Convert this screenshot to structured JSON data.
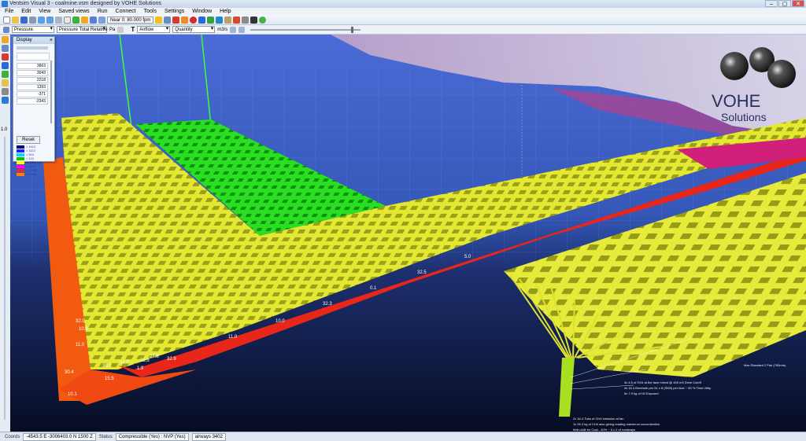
{
  "window": {
    "title": "Ventsim Visual 3 - coalmine.vsm designed by VOHE Solutions",
    "buttons": [
      "–",
      "▢",
      "✕"
    ]
  },
  "menu": [
    "File",
    "Edit",
    "View",
    "Saved views",
    "Run",
    "Connect",
    "Tools",
    "Settings",
    "Window",
    "Help"
  ],
  "toolbar": {
    "speed_label": "Near 0: 80.000 fpm",
    "icons": [
      "new-icon",
      "open-icon",
      "save-icon",
      "print-icon",
      "undo-icon",
      "redo-icon",
      "select-icon",
      "add-icon",
      "edit-icon",
      "copy-icon",
      "move-icon",
      "delete-icon",
      "info-icon",
      "block-icon",
      "fan-icon",
      "view-icon",
      "simulate-icon",
      "heat-icon",
      "contaminant-icon",
      "gas-icon",
      "settings-icon",
      "camera-icon",
      "help-icon"
    ]
  },
  "toolbar2": {
    "data_select": "Pressure",
    "sub_select": "Pressure Total Relative",
    "unit_hint": "Pa",
    "text_prefix": "T",
    "text_select": "Airflow",
    "text_sub_select": "Quantity",
    "text_unit": "m3/s"
  },
  "display_panel": {
    "title": "Display",
    "values": [
      "3663",
      "3043",
      "2218",
      "1393",
      "-371",
      "-2343"
    ],
    "reset": "Reset",
    "legend": [
      {
        "color": "#000080",
        "label": "> 1612"
      },
      {
        "color": "#2020ff",
        "label": "> 1113"
      },
      {
        "color": "#00d8ff",
        "label": "> 614"
      },
      {
        "color": "#10c010",
        "label": "> 115"
      },
      {
        "color": "#ffff00",
        "label": "> -384"
      },
      {
        "color": "#ff00ff",
        "label": "> -883"
      },
      {
        "color": "#ff2020",
        "label": "> -1382"
      },
      {
        "color": "#ff8000",
        "label": "> -1881"
      },
      {
        "color": "#404040",
        "label": "< -2380"
      }
    ]
  },
  "left_tool_label": "1.0",
  "brand": {
    "line1": "VOHE",
    "line2": "Solutions"
  },
  "overlay_numbers": [
    "30.3",
    "32.3",
    "34.0",
    "27.8",
    "1.9",
    "15.5",
    "30.4",
    "11.0",
    "10.1",
    "10.3",
    "32.9",
    "32.0",
    "11.0",
    "10.0",
    "32.3",
    "0.1",
    "32.5",
    "5.0"
  ],
  "annotations": [
    "3x 4.5 of CH4 at the face mixed @ 400 m3 Drive Cutoff",
    "4x 16.4 Borehole per 51 x 8 (SM5) per face ~ 50 % Time Utilty",
    "5x 7.9 kg of H2 Exposed",
    "2x 16.4 Tubs of CH4 emission at fan",
    "1x 26.3 kg of CH4 also giving reading maximum concentration",
    "Main Adit for Coal - 40% ~ 6 x 2 of roadways"
  ],
  "fan_annotation": "Max Standard 2 Fan (760mm)",
  "status": {
    "coords_label": "Coords",
    "coords": "-4543.5 E -3006403.0 N 1500 Z",
    "status_label": "Status",
    "mode": "Compressible (Yes) : NVP (Yes)",
    "airways": "airways 3402"
  },
  "colors": {
    "sky_top": "#4f6fd6",
    "floor": "#0b1a3a",
    "yellow": "#e4e832",
    "green": "#22d31e",
    "red": "#e8261a",
    "orange": "#f25a10",
    "magenta": "#d0207a"
  }
}
